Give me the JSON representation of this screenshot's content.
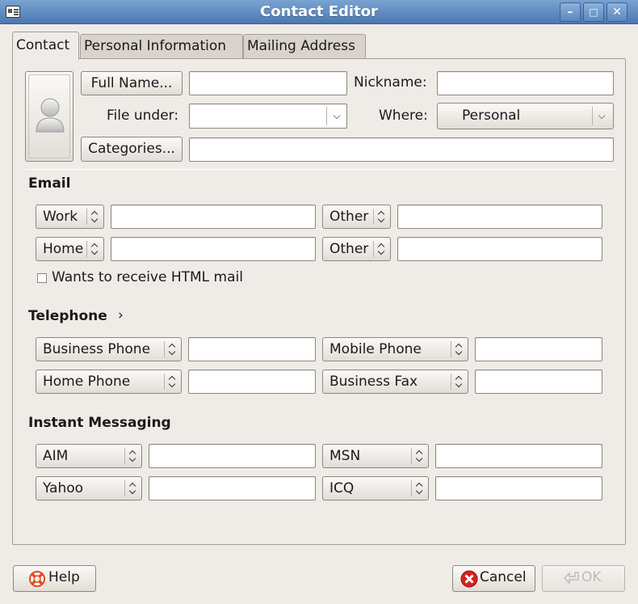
{
  "window": {
    "title": "Contact Editor",
    "controls": {
      "minimize": "–",
      "maximize": "□",
      "close": "✕"
    }
  },
  "tabs": [
    "Contact",
    "Personal Information",
    "Mailing Address"
  ],
  "identity": {
    "full_name_button": "Full Name...",
    "full_name_value": "",
    "nickname_label": "Nickname:",
    "nickname_value": "",
    "file_under_label": "File under:",
    "file_under_value": "",
    "where_label": "Where:",
    "where_value": "Personal",
    "categories_button": "Categories...",
    "categories_value": ""
  },
  "email": {
    "heading": "Email",
    "rows": [
      {
        "type1": "Work",
        "value1": "",
        "type2": "Other",
        "value2": ""
      },
      {
        "type1": "Home",
        "value1": "",
        "type2": "Other",
        "value2": ""
      }
    ],
    "html_mail_label": "Wants to receive HTML mail",
    "html_mail_checked": false
  },
  "telephone": {
    "heading": "Telephone",
    "expander": "›",
    "rows": [
      {
        "type1": "Business Phone",
        "value1": "",
        "type2": "Mobile Phone",
        "value2": ""
      },
      {
        "type1": "Home Phone",
        "value1": "",
        "type2": "Business Fax",
        "value2": ""
      }
    ]
  },
  "im": {
    "heading": "Instant Messaging",
    "rows": [
      {
        "type1": "AIM",
        "value1": "",
        "type2": "MSN",
        "value2": ""
      },
      {
        "type1": "Yahoo",
        "value1": "",
        "type2": "ICQ",
        "value2": ""
      }
    ]
  },
  "footer": {
    "help_label": "Help",
    "cancel_label": "Cancel",
    "ok_label": "OK",
    "ok_enabled": false
  },
  "colors": {
    "titlebar": "#4b78b2",
    "background": "#efebe7",
    "cancel_icon": "#d62020",
    "help_icon": "#e34b1b"
  },
  "icons": {
    "window": "contact-card-icon",
    "photo": "person-placeholder-icon",
    "help": "lifebuoy-icon",
    "cancel": "cancel-icon",
    "ok": "ok-arrow-icon"
  }
}
